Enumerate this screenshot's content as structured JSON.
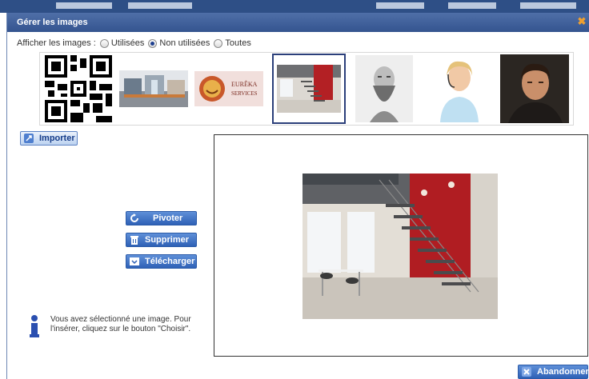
{
  "dialog": {
    "title": "Gérer les images",
    "close_icon": "close-icon"
  },
  "filter": {
    "label": "Afficher les images :",
    "options": [
      {
        "label": "Utilisées",
        "checked": false
      },
      {
        "label": "Non utilisées",
        "checked": true
      },
      {
        "label": "Toutes",
        "checked": false
      }
    ]
  },
  "thumbnails": [
    {
      "name": "qr-code-image",
      "selected": false
    },
    {
      "name": "office-building-image",
      "selected": false
    },
    {
      "name": "eureka-services-logo-image",
      "selected": false
    },
    {
      "name": "staircase-interior-image",
      "selected": true
    },
    {
      "name": "bearded-man-sketch-image",
      "selected": false
    },
    {
      "name": "woman-headset-image",
      "selected": false
    },
    {
      "name": "man-portrait-image",
      "selected": false
    }
  ],
  "thumbnail_texts": {
    "eureka_line1": "EURÊKA",
    "eureka_line2": "SERVICES"
  },
  "buttons": {
    "import": "Importer",
    "rotate": "Pivoter",
    "delete": "Supprimer",
    "download": "Télécharger",
    "abandon": "Abandonner"
  },
  "info": {
    "text": "Vous avez sélectionné une image. Pour l'insérer, cliquez sur le bouton \"Choisir\"."
  },
  "colors": {
    "titlebar": "#3f5f9c",
    "selected_border": "#2b3f7a",
    "action_button": "#2e61b6",
    "accent_red": "#b32024"
  }
}
